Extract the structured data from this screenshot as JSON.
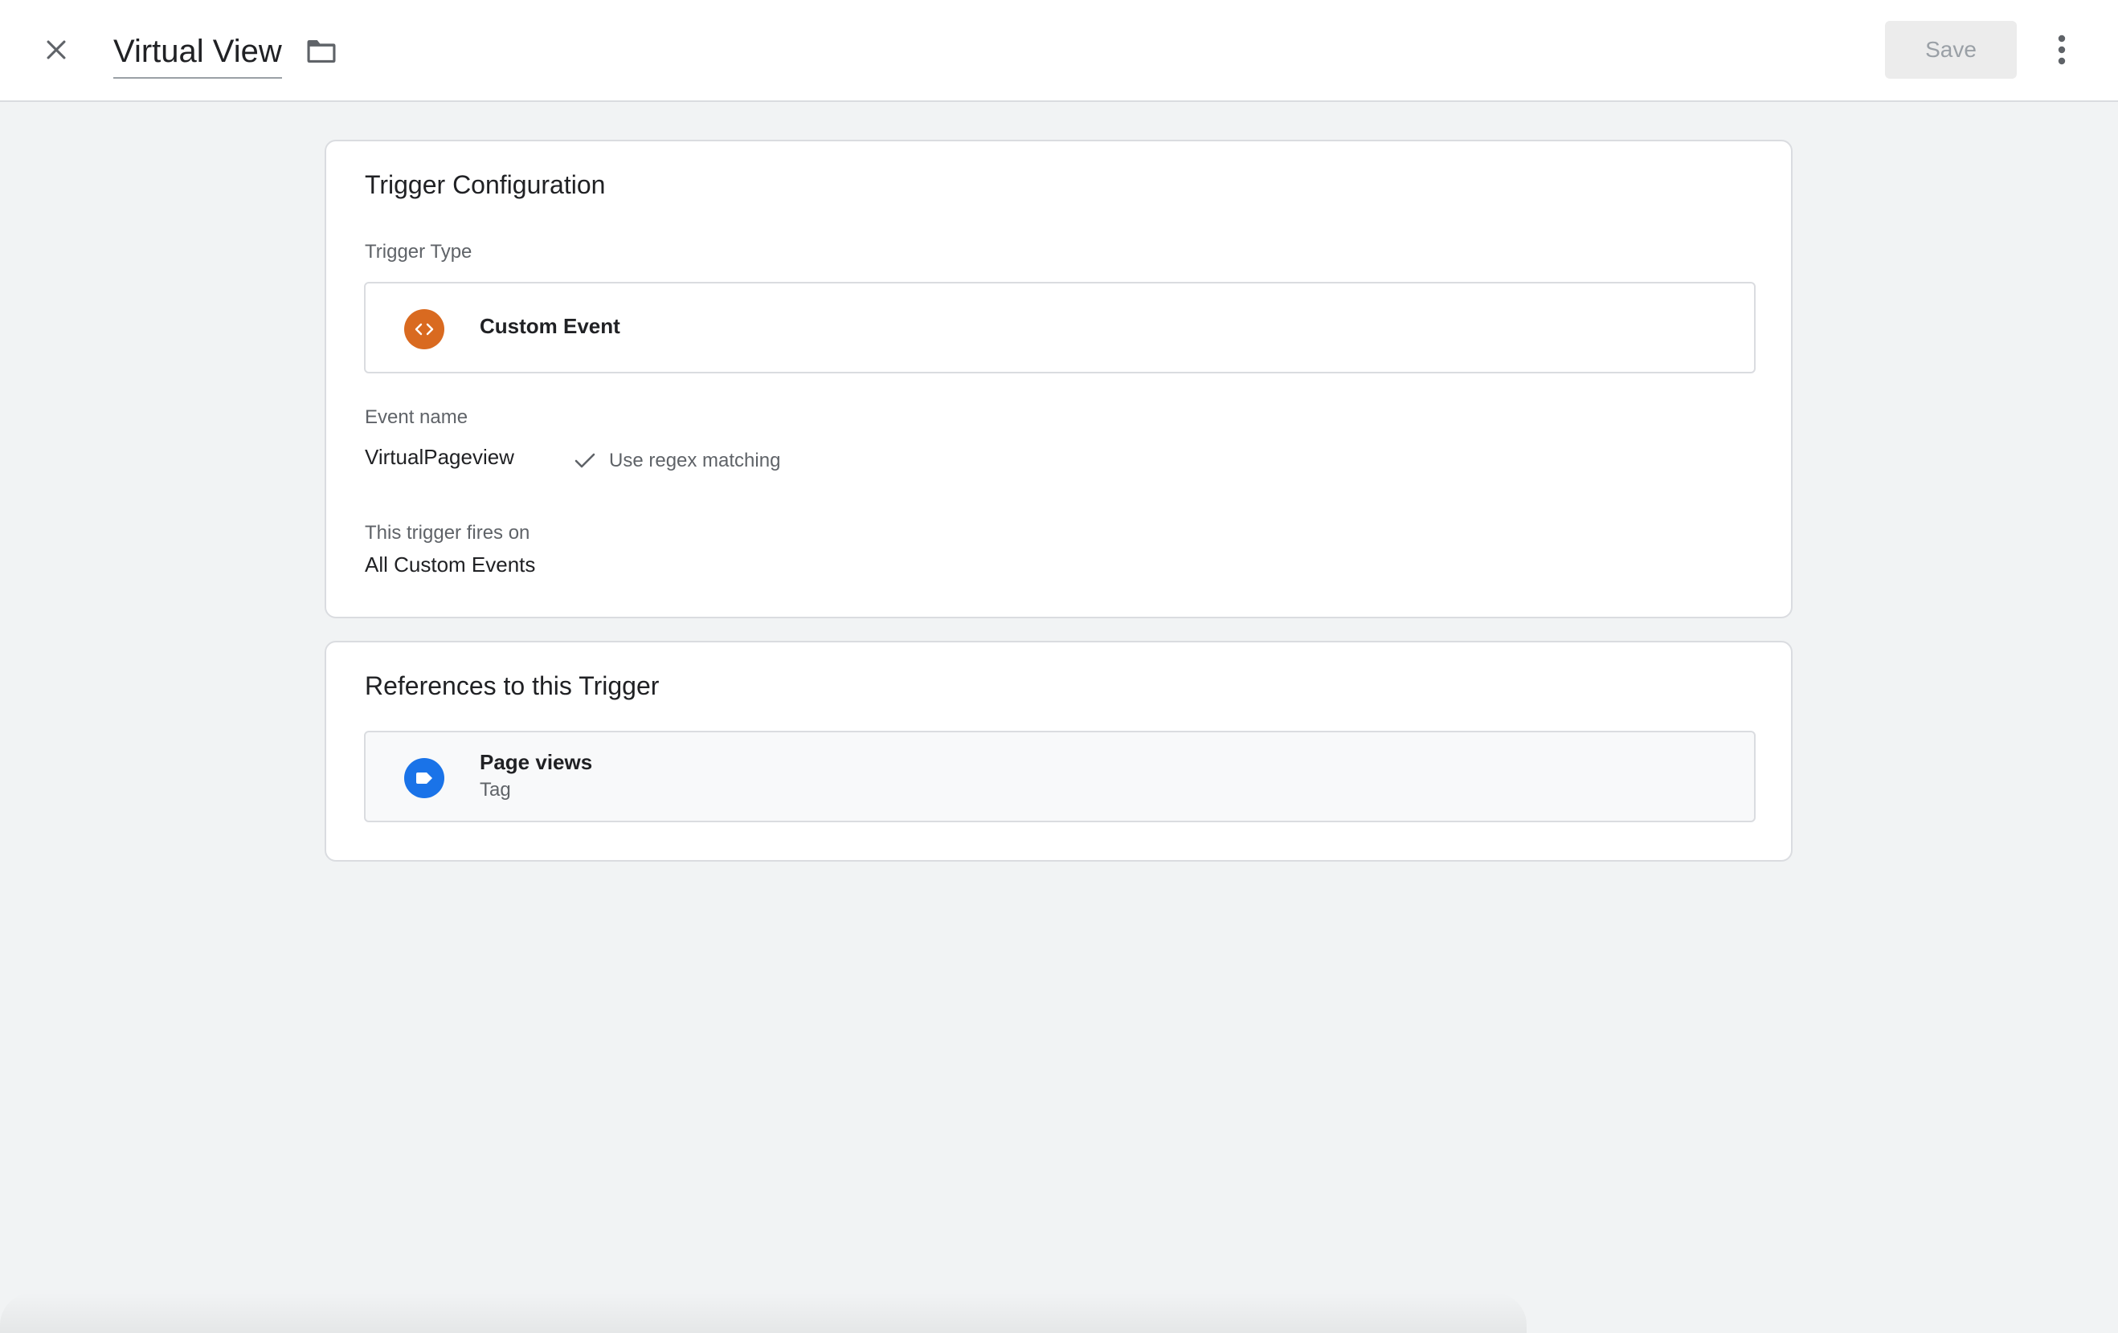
{
  "header": {
    "title": "Virtual View",
    "save_label": "Save",
    "close_icon": "close-icon",
    "folder_icon": "folder-icon",
    "more_icon": "more-vert-icon"
  },
  "trigger_config": {
    "title": "Trigger Configuration",
    "type_label": "Trigger Type",
    "type_name": "Custom Event",
    "type_icon": "code-brackets-icon",
    "type_icon_color": "#e37400",
    "event_name_label": "Event name",
    "event_name_value": "VirtualPageview",
    "regex_label": "Use regex matching",
    "regex_checked": true,
    "fires_on_label": "This trigger fires on",
    "fires_on_value": "All Custom Events"
  },
  "references": {
    "title": "References to this Trigger",
    "items": [
      {
        "name": "Page views",
        "kind": "Tag",
        "icon": "tag-icon",
        "icon_color": "#1a73e8"
      }
    ]
  }
}
